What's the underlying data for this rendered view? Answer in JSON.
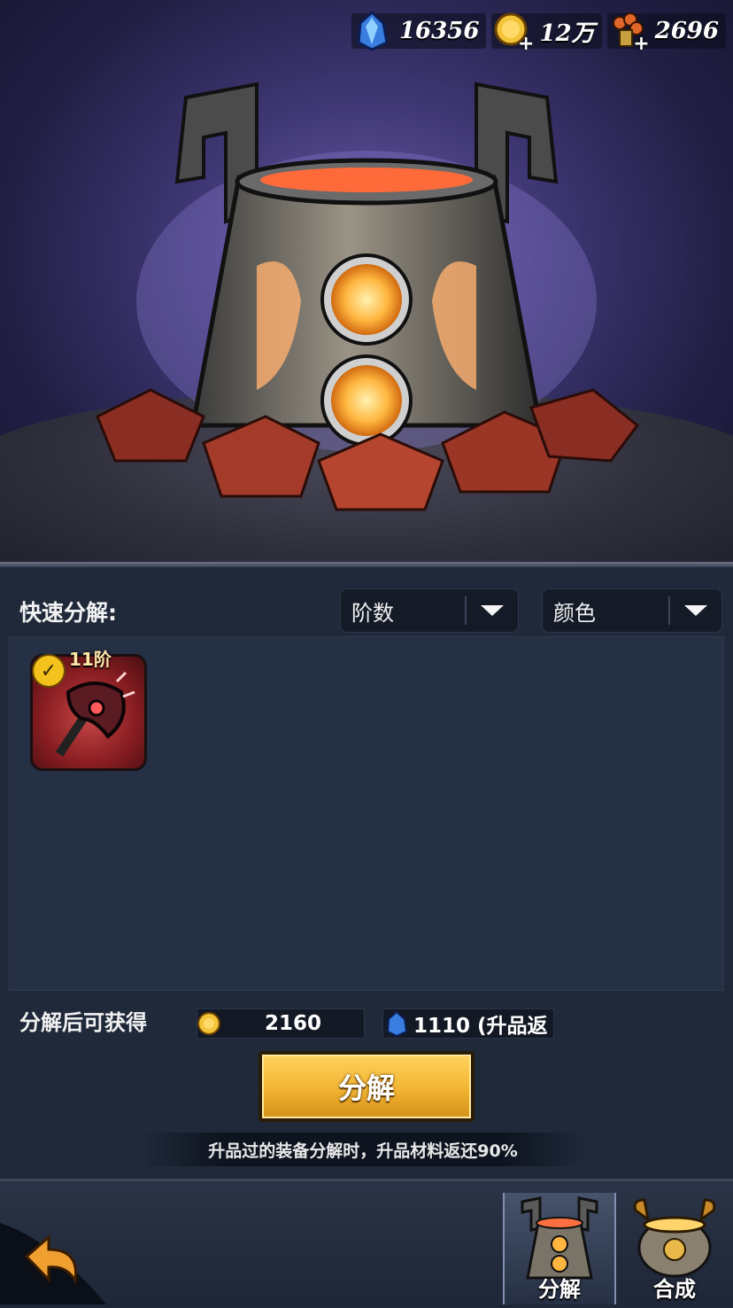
{
  "currencies": [
    {
      "icon": "crystal-icon",
      "value": "16356"
    },
    {
      "icon": "gold-coin-icon",
      "value": "12万",
      "has_plus": true
    },
    {
      "icon": "bundle-icon",
      "value": "2696",
      "has_plus": true
    }
  ],
  "filter": {
    "label": "快速分解:",
    "tier_dropdown": "阶数",
    "color_dropdown": "颜色"
  },
  "items": [
    {
      "tier": "11阶",
      "selected": true,
      "icon": "red-axe-equipment-icon"
    }
  ],
  "rewards": {
    "label": "分解后可获得",
    "gold": "2160",
    "crystal": "1110 (升品返"
  },
  "action": {
    "decompose_label": "分解",
    "note": "升品过的装备分解时，升品材料返还90%"
  },
  "tabs": [
    {
      "label": "分解",
      "active": true,
      "icon": "cauldron-icon"
    },
    {
      "label": "合成",
      "active": false,
      "icon": "golden-cauldron-icon"
    }
  ],
  "colors": {
    "accent": "#f1b432",
    "panel": "#1f293a"
  }
}
